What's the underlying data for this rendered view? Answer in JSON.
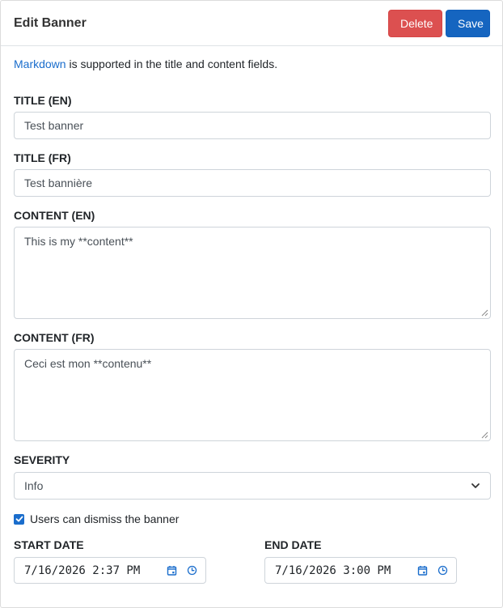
{
  "header": {
    "title": "Edit Banner",
    "delete_label": "Delete",
    "save_label": "Save"
  },
  "hint": {
    "link_text": "Markdown",
    "text": " is supported in the title and content fields."
  },
  "form": {
    "title_en": {
      "label": "TITLE (EN)",
      "value": "Test banner"
    },
    "title_fr": {
      "label": "TITLE (FR)",
      "value": "Test bannière"
    },
    "content_en": {
      "label": "CONTENT (EN)",
      "value": "This is my **content**"
    },
    "content_fr": {
      "label": "CONTENT (FR)",
      "value": "Ceci est mon **contenu**"
    },
    "severity": {
      "label": "SEVERITY",
      "value": "Info"
    },
    "dismiss": {
      "label": "Users can dismiss the banner",
      "checked": true
    },
    "start_date": {
      "label": "START DATE",
      "value": "7/16/2026 2:37 PM"
    },
    "end_date": {
      "label": "END DATE",
      "value": "7/16/2026 3:00 PM"
    }
  },
  "colors": {
    "delete": "#dc5050",
    "save": "#1565c0",
    "link": "#1a6dcc",
    "icon_blue": "#1a6dcc"
  },
  "icons": {
    "calendar": "calendar-icon",
    "clock": "clock-icon",
    "chevron": "chevron-down-icon",
    "check": "checkmark-icon"
  }
}
